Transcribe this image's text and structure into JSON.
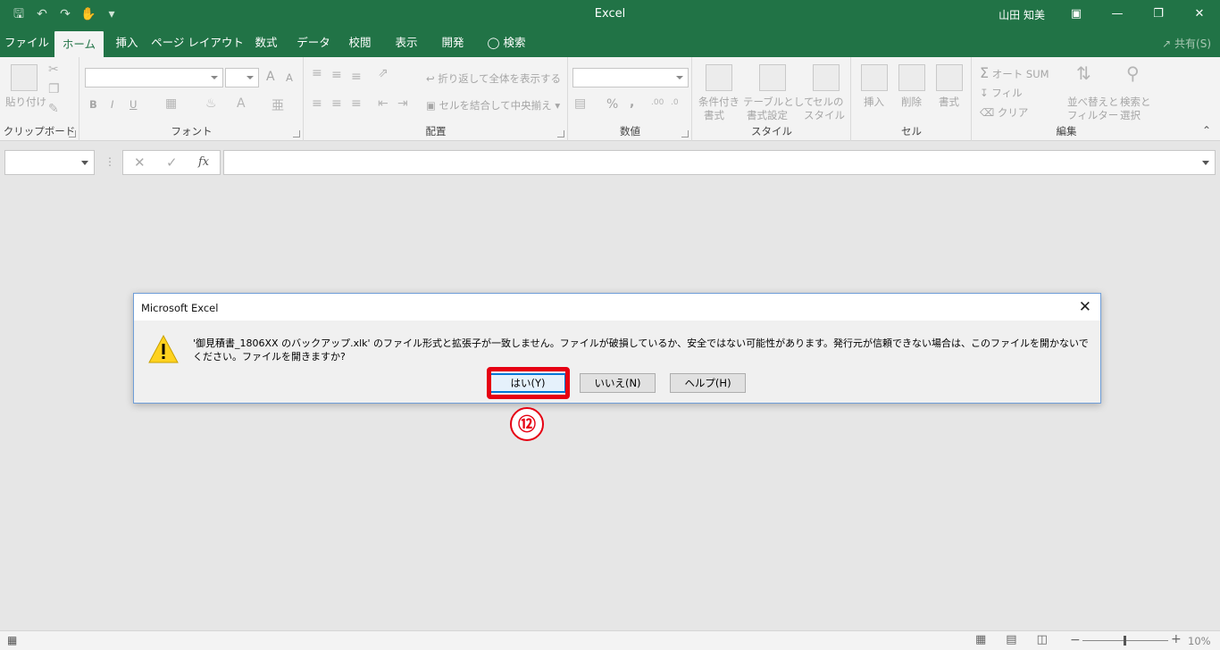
{
  "titlebar": {
    "app_title": "Excel",
    "user_name": "山田 知美",
    "qat_icons": [
      "save-icon",
      "undo-icon",
      "redo-icon",
      "touch-mode-icon",
      "customize-qat-icon"
    ],
    "window_controls": [
      "ribbon-display-icon",
      "minimize-icon",
      "restore-icon",
      "close-icon"
    ]
  },
  "tabs": {
    "file": "ファイル",
    "home": "ホーム",
    "insert": "挿入",
    "page_layout": "ページ レイアウト",
    "formulas": "数式",
    "data": "データ",
    "review": "校閲",
    "view": "表示",
    "developer": "開発",
    "search": "検索",
    "share": "共有(S)"
  },
  "ribbon": {
    "clipboard": {
      "paste": "貼り付け",
      "label": "クリップボード"
    },
    "font": {
      "label": "フォント",
      "bold": "B",
      "italic": "I",
      "underline": "U",
      "grow": "A",
      "shrink": "A"
    },
    "alignment": {
      "wrap": "折り返して全体を表示する",
      "merge": "セルを結合して中央揃え",
      "label": "配置"
    },
    "number": {
      "percent": "%",
      "comma": ",",
      "label": "数値"
    },
    "styles": {
      "conditional": "条件付き",
      "conditional2": "書式",
      "table": "テーブルとして",
      "table2": "書式設定",
      "cell": "セルの",
      "cell2": "スタイル",
      "label": "スタイル"
    },
    "cells": {
      "insert": "挿入",
      "delete": "削除",
      "format": "書式",
      "label": "セル"
    },
    "editing": {
      "autosum": "オート SUM",
      "fill": "フィル",
      "clear": "クリア",
      "sort": "並べ替えと",
      "sort2": "フィルター",
      "find": "検索と",
      "find2": "選択",
      "label": "編集"
    }
  },
  "formula_bar": {
    "cancel": "✕",
    "enter": "✓",
    "fx": "fx"
  },
  "dialog": {
    "title": "Microsoft Excel",
    "message": "'御見積書_1806XX のバックアップ.xlk' のファイル形式と拡張子が一致しません。ファイルが破損しているか、安全ではない可能性があります。発行元が信頼できない場合は、このファイルを開かないでください。ファイルを開きますか?",
    "yes": "はい(Y)",
    "no": "いいえ(N)",
    "help": "ヘルプ(H)"
  },
  "annotation": {
    "step": "⑫",
    "color": "#e60012"
  },
  "statusbar": {
    "zoom": "10%"
  },
  "colors": {
    "excel_green": "#217346",
    "dialog_accent": "#0078d7"
  }
}
